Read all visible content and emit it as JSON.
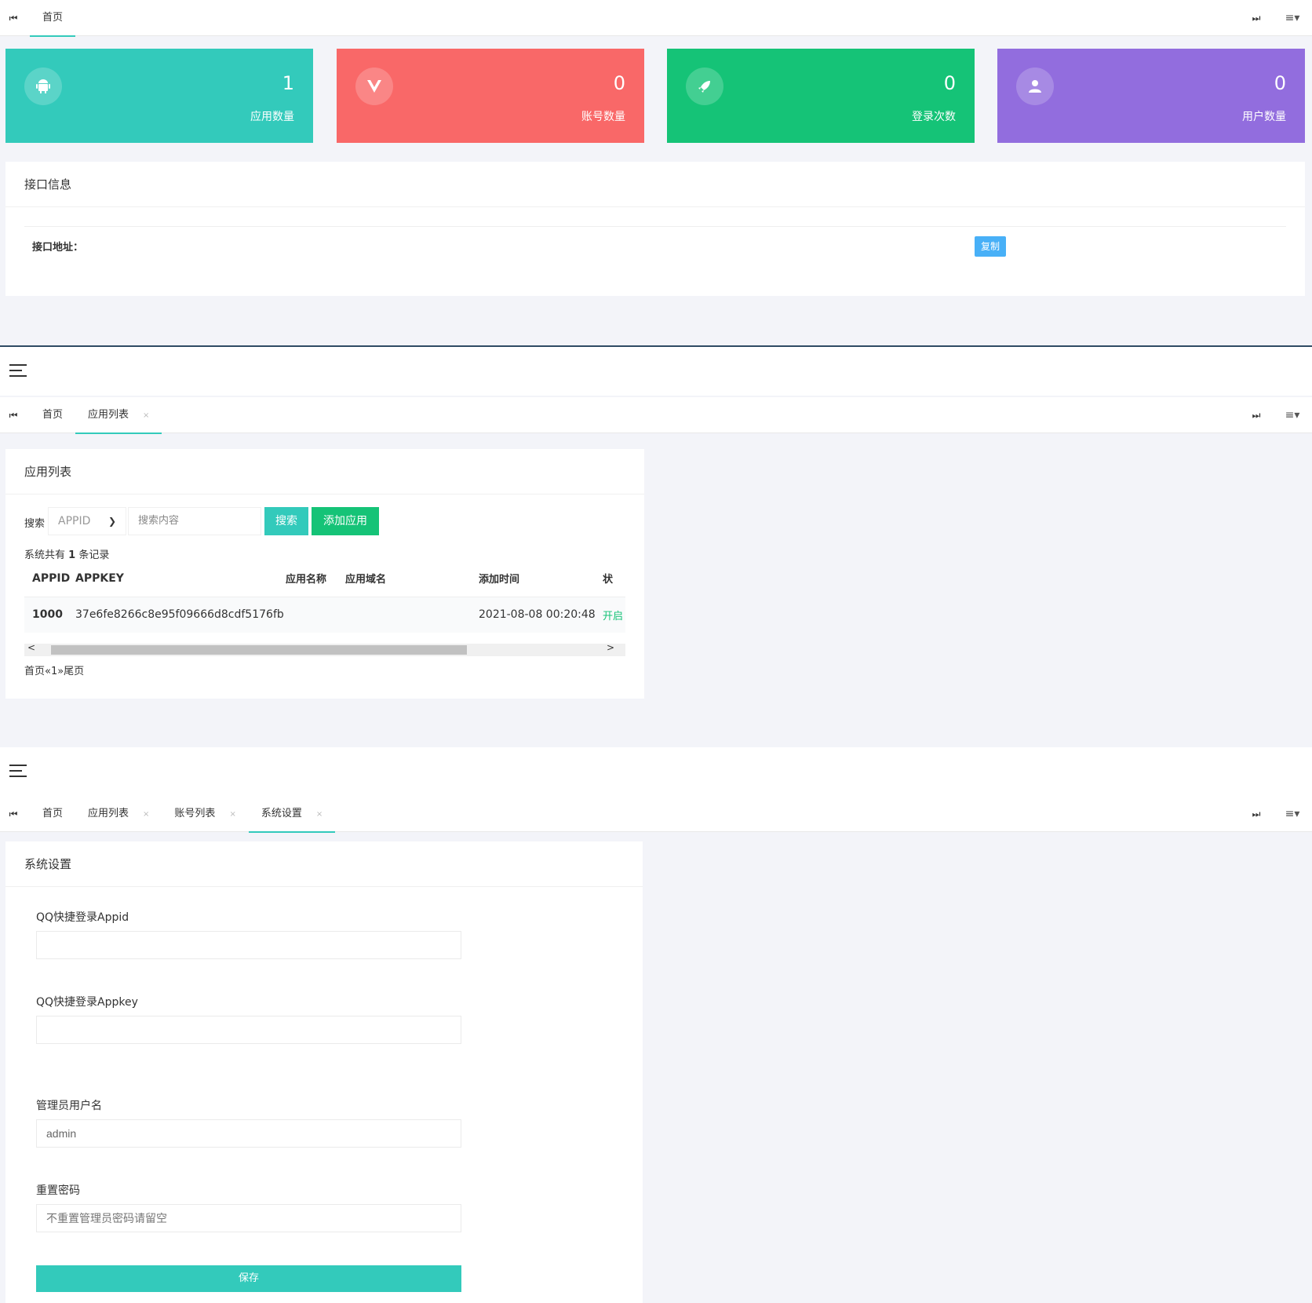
{
  "colors": {
    "teal": "#33cabb",
    "red": "#f96868",
    "green": "#15c377",
    "purple": "#926dde",
    "blue": "#48b0f7"
  },
  "nav": {
    "prev_icon": "⏮",
    "next_icon": "⏭",
    "menu_icon": "≡▾",
    "hamburger_icon": "hamburger-icon"
  },
  "dashboard": {
    "tabs": [
      {
        "label": "首页"
      }
    ],
    "stats": [
      {
        "icon": "android-icon",
        "value": "1",
        "label": "应用数量"
      },
      {
        "icon": "vue-icon",
        "value": "0",
        "label": "账号数量"
      },
      {
        "icon": "rocket-icon",
        "value": "0",
        "label": "登录次数"
      },
      {
        "icon": "user-icon",
        "value": "0",
        "label": "用户数量"
      }
    ],
    "api_card": {
      "title": "接口信息",
      "url_label": "接口地址：",
      "copy_label": "复制"
    }
  },
  "app_list": {
    "tabs": [
      {
        "label": "首页"
      },
      {
        "label": "应用列表",
        "close": "×"
      }
    ],
    "title": "应用列表",
    "search_label": "搜索",
    "select_value": "APPID",
    "search_placeholder": "搜索内容",
    "search_button": "搜索",
    "add_button": "添加应用",
    "record_prefix": "系统共有",
    "record_count": "1",
    "record_suffix": "条记录",
    "columns": [
      "APPID",
      "APPKEY",
      "应用名称",
      "应用域名",
      "添加时间",
      "状"
    ],
    "rows": [
      {
        "appid": "1000",
        "appkey": "37e6fe8266c8e95f09666d8cdf5176fb",
        "name": "",
        "domain": "",
        "time": "2021-08-08 00:20:48",
        "status": "开启"
      }
    ],
    "pagination": "首页«1»尾页"
  },
  "settings": {
    "tabs": [
      {
        "label": "首页"
      },
      {
        "label": "应用列表",
        "close": "×"
      },
      {
        "label": "账号列表",
        "close": "×"
      },
      {
        "label": "系统设置",
        "close": "×"
      }
    ],
    "title": "系统设置",
    "fields": [
      {
        "label": "QQ快捷登录Appid",
        "value": "",
        "placeholder": ""
      },
      {
        "label": "QQ快捷登录Appkey",
        "value": "",
        "placeholder": ""
      },
      {
        "label": "管理员用户名",
        "value": "admin",
        "placeholder": ""
      },
      {
        "label": "重置密码",
        "value": "",
        "placeholder": "不重置管理员密码请留空"
      }
    ],
    "save_button": "保存"
  }
}
